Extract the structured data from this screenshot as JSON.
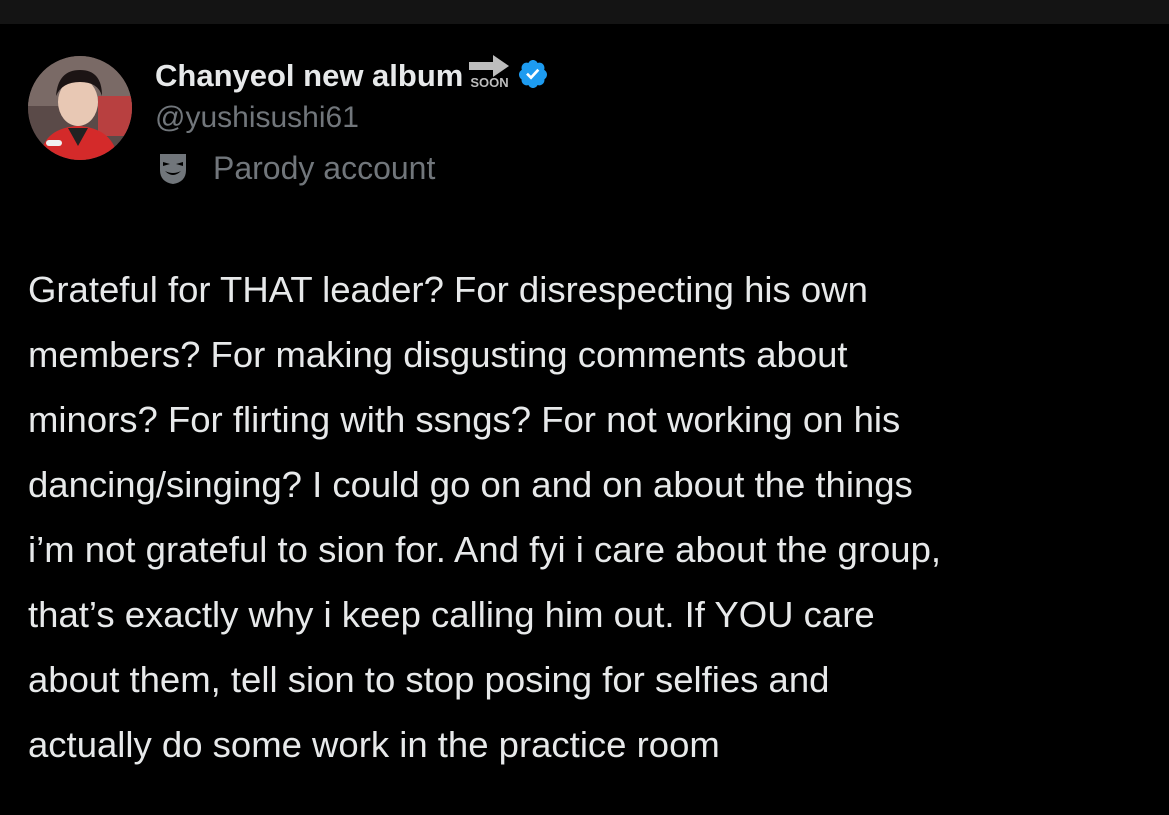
{
  "author": {
    "display_name": "Chanyeol new album",
    "soon_label": "SOON",
    "handle": "@yushisushi61",
    "parody_label": "Parody account",
    "avatar_icon": "profile-photo",
    "verified_icon": "verified-badge-icon",
    "parody_icon": "theater-mask-icon"
  },
  "tweet": {
    "lines": [
      "Grateful for THAT leader? For disrespecting his own",
      "members? For making disgusting comments about",
      "minors? For flirting with ssngs? For not working on his",
      "dancing/singing? I could go on and on about the things",
      "i’m not grateful to sion for. And fyi i care about the group,",
      "that’s exactly why i keep calling him out. If YOU care",
      "about them, tell sion to stop posing for selfies and",
      "actually do some work in the practice room"
    ]
  },
  "colors": {
    "background": "#000000",
    "text_primary": "#e7e9ea",
    "text_secondary": "#71767b",
    "verified_blue": "#1d9bf0"
  }
}
